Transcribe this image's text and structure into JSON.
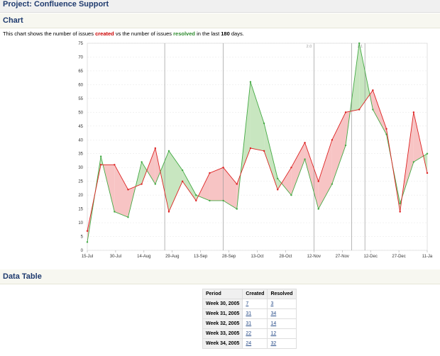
{
  "project": {
    "title": "Project: Confluence Support"
  },
  "chart_section": {
    "title": "Chart"
  },
  "description": {
    "prefix": "This chart shows the number of issues ",
    "created": "created",
    "middle": " vs the number of issues ",
    "resolved": "resolved",
    "suffix_pre": " in the last ",
    "days": "180",
    "suffix_post": " days."
  },
  "colors": {
    "created": "#dd2222",
    "resolved": "#44aa44",
    "created_fill": "#f7c4c4",
    "resolved_fill": "#c8e6c0",
    "heading": "#1e3a6e"
  },
  "chart_data": {
    "type": "area",
    "title": "",
    "xlabel": "",
    "ylabel": "",
    "ylim": [
      0,
      75
    ],
    "yticks": [
      0,
      5,
      10,
      15,
      20,
      25,
      30,
      35,
      40,
      45,
      50,
      55,
      60,
      65,
      70,
      75
    ],
    "xtick_labels": [
      "15-Jul",
      "30-Jul",
      "14-Aug",
      "29-Aug",
      "13-Sep",
      "28-Sep",
      "13-Oct",
      "28-Oct",
      "12-Nov",
      "27-Nov",
      "12-Dec",
      "27-Dec",
      "11-Ja"
    ],
    "x_day_index": [
      0,
      2,
      7,
      10,
      14,
      17,
      21,
      24,
      28,
      31,
      35,
      38,
      42,
      45,
      49,
      52,
      56,
      59,
      63,
      66,
      70,
      73,
      77,
      80,
      84,
      87,
      91,
      94,
      98,
      101,
      105,
      108,
      112,
      115,
      119,
      122,
      126,
      129,
      133,
      136,
      140,
      143,
      147,
      150,
      154,
      157,
      161,
      164,
      168,
      171,
      175,
      178,
      180
    ],
    "series": [
      {
        "name": "created",
        "values": [
          7,
          31,
          31,
          22,
          24,
          37,
          14,
          25,
          18,
          28,
          30,
          24,
          37,
          36,
          22,
          30,
          39,
          25,
          40,
          50,
          51,
          58,
          44,
          14,
          50,
          28
        ]
      },
      {
        "name": "resolved",
        "values": [
          3,
          34,
          14,
          12,
          32,
          24,
          36,
          29,
          20,
          18,
          18,
          15,
          61,
          46,
          26,
          20,
          33,
          15,
          24,
          38,
          75,
          51,
          42,
          17,
          32,
          35
        ]
      }
    ],
    "versions": [
      {
        "label": "",
        "day": 41
      },
      {
        "label": "",
        "day": 72
      },
      {
        "label": "2.0",
        "day": 120
      },
      {
        "label": "",
        "day": 140
      },
      {
        "label": "2.1",
        "day": 147
      }
    ],
    "grid": true,
    "legend": "none"
  },
  "data_table": {
    "title": "Data Table",
    "headers": [
      "Period",
      "Created",
      "Resolved"
    ],
    "rows": [
      {
        "period": "Week 30, 2005",
        "created": "7",
        "resolved": "3"
      },
      {
        "period": "Week 31, 2005",
        "created": "31",
        "resolved": "34"
      },
      {
        "period": "Week 32, 2005",
        "created": "31",
        "resolved": "14"
      },
      {
        "period": "Week 33, 2005",
        "created": "22",
        "resolved": "12"
      },
      {
        "period": "Week 34, 2005",
        "created": "24",
        "resolved": "32"
      }
    ]
  }
}
